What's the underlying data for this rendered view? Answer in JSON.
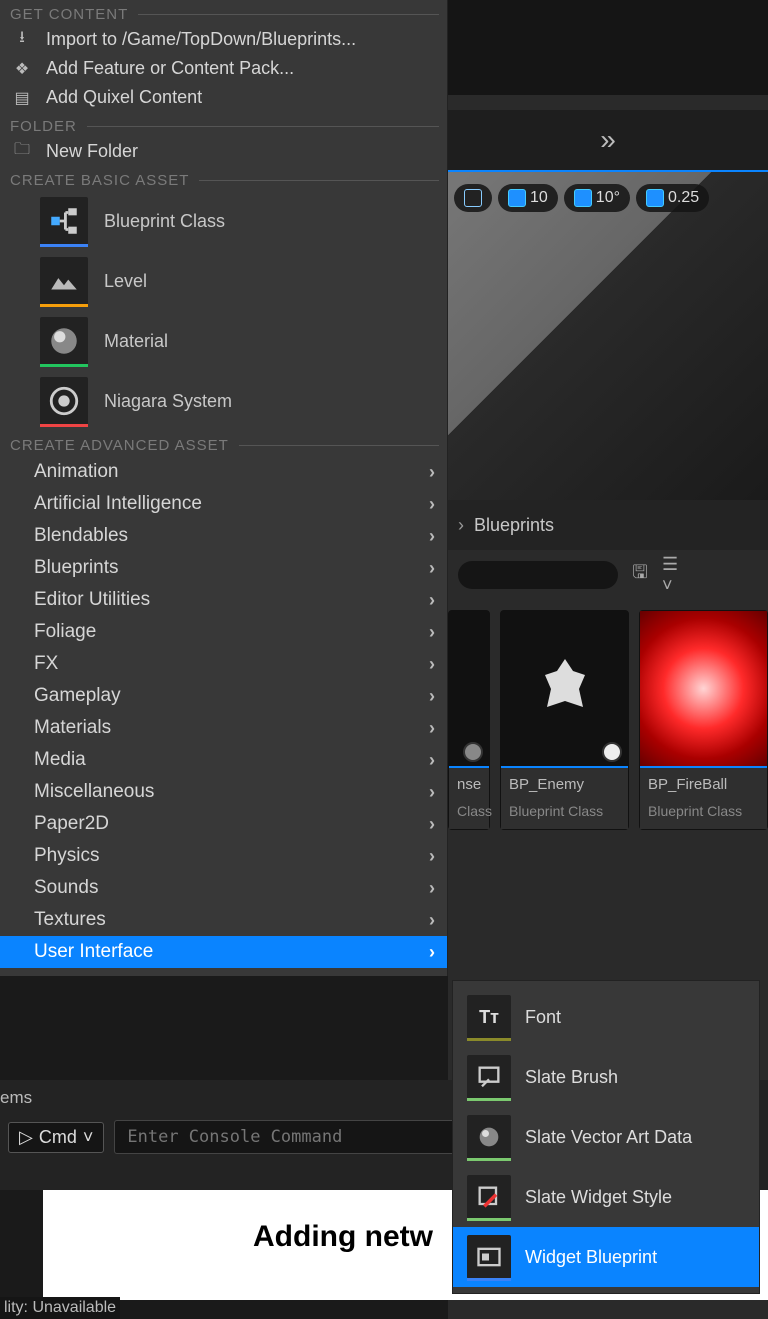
{
  "toolbar": {
    "grid_snap": "10",
    "angle_snap": "10°",
    "scale_snap": "0.25"
  },
  "breadcrumb": {
    "folder": "Blueprints"
  },
  "contextMenu": {
    "sections": {
      "get": "GET CONTENT",
      "folder": "FOLDER",
      "basic": "CREATE BASIC ASSET",
      "adv": "CREATE ADVANCED ASSET"
    },
    "getContent": {
      "import": "Import to /Game/TopDown/Blueprints...",
      "feature": "Add Feature or Content Pack...",
      "quixel": "Add Quixel Content"
    },
    "folder": {
      "new": "New Folder"
    },
    "basic": {
      "blueprint": "Blueprint Class",
      "level": "Level",
      "material": "Material",
      "niagara": "Niagara System"
    },
    "advanced": [
      "Animation",
      "Artificial Intelligence",
      "Blendables",
      "Blueprints",
      "Editor Utilities",
      "Foliage",
      "FX",
      "Gameplay",
      "Materials",
      "Media",
      "Miscellaneous",
      "Paper2D",
      "Physics",
      "Sounds",
      "Textures",
      "User Interface"
    ]
  },
  "uiSubmenu": [
    "Font",
    "Slate Brush",
    "Slate Vector Art Data",
    "Slate Widget Style",
    "Widget Blueprint"
  ],
  "assets": [
    {
      "name": "nse",
      "type": "Class"
    },
    {
      "name": "BP_Enemy",
      "type": "Blueprint Class"
    },
    {
      "name": "BP_FireBall",
      "type": "Blueprint Class"
    }
  ],
  "console": {
    "tab": "ems",
    "cmd": "Cmd",
    "placeholder": "Enter Console Command"
  },
  "banner": {
    "text": "Adding netw"
  },
  "status": {
    "text": "lity: Unavailable"
  }
}
